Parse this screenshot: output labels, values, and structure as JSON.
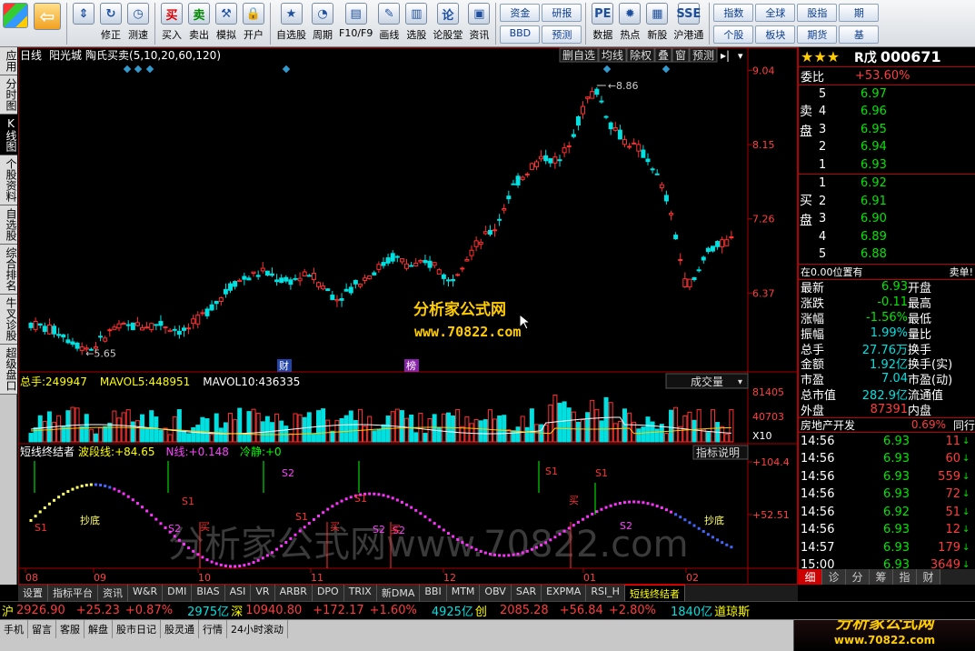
{
  "toolbar": {
    "groups": [
      [
        {
          "label": "",
          "icon": "windows-logo"
        },
        {
          "label": "",
          "icon": "back-arrow"
        }
      ],
      [
        {
          "label": "",
          "icon": "up-down-arrows"
        },
        {
          "label": "修正",
          "icon": "refresh-icon"
        },
        {
          "label": "测速",
          "icon": "clock-icon"
        }
      ],
      [
        {
          "label": "买入",
          "icon": "buy-icon",
          "glyph": "买"
        },
        {
          "label": "卖出",
          "icon": "sell-icon",
          "glyph": "卖"
        },
        {
          "label": "模拟",
          "icon": "hammer-icon"
        },
        {
          "label": "开户",
          "icon": "lock-icon"
        }
      ],
      [
        {
          "label": "自选股",
          "icon": "star-icon"
        },
        {
          "label": "周期",
          "icon": "cycle-icon"
        },
        {
          "label": "F10/F9",
          "icon": "f10-icon"
        },
        {
          "label": "画线",
          "icon": "pen-icon"
        },
        {
          "label": "选股",
          "icon": "pick-icon"
        },
        {
          "label": "论股堂",
          "icon": "forum-icon",
          "glyph": "论"
        },
        {
          "label": "资讯",
          "icon": "news-icon"
        }
      ],
      [
        {
          "label": "资金",
          "small": true
        },
        {
          "label": "研报",
          "small": true
        },
        {
          "label": "BBD",
          "small": true
        },
        {
          "label": "预测",
          "small": true
        }
      ],
      [
        {
          "label": "数据",
          "icon": "pe-icon",
          "glyph": "PE"
        },
        {
          "label": "热点",
          "icon": "fire-icon"
        },
        {
          "label": "新股",
          "icon": "new-stock-icon"
        },
        {
          "label": "沪港通",
          "icon": "hk-icon",
          "glyph": "SSE"
        }
      ],
      [
        {
          "label": "指数",
          "small": true
        },
        {
          "label": "全球",
          "small": true
        },
        {
          "label": "股指",
          "small": true
        },
        {
          "label": "期",
          "small": true
        },
        {
          "label": "个股",
          "small": true
        },
        {
          "label": "板块",
          "small": true
        },
        {
          "label": "期货",
          "small": true
        },
        {
          "label": "基",
          "small": true
        }
      ]
    ]
  },
  "left_tabs": [
    {
      "label": "应用"
    },
    {
      "label": "分时图"
    },
    {
      "label": "K线图",
      "active": true
    },
    {
      "label": "个股资料"
    },
    {
      "label": "自选股"
    },
    {
      "label": "综合排名"
    },
    {
      "label": "牛叉诊股"
    },
    {
      "label": "超级盘口"
    }
  ],
  "main_chart": {
    "title_left": "日线",
    "stock_name": "阳光城",
    "indicator": "陶氏买卖(5,10,20,60,120)",
    "buttons": [
      "删自选",
      "均线",
      "除权",
      "叠",
      "窗",
      "预测"
    ],
    "price_labels": [
      "9.04",
      "8.15",
      "7.26",
      "6.37"
    ],
    "high_mark": "8.86",
    "low_mark": "5.65",
    "event_marks": [
      "财",
      "榜"
    ],
    "watermark_cn": "分析家公式网",
    "watermark_url": "www.70822.com"
  },
  "volume_panel": {
    "label_total": "总手:",
    "total": "249947",
    "mavol5_label": "MAVOL5:",
    "mavol5": "448951",
    "mavol10_label": "MAVOL10:",
    "mavol10": "436335",
    "dropdown": "成交量",
    "axis": [
      "81405",
      "40703",
      "X10"
    ]
  },
  "indicator_panel": {
    "name": "短线终结者",
    "wave_label": "波段线:",
    "wave": "+84.65",
    "n_label": "N线:",
    "n": "+0.148",
    "calm_label": "冷静:",
    "calm": "+0",
    "button": "指标说明",
    "axis": [
      "+104.4",
      "+52.51"
    ],
    "labels": [
      "S1",
      "抄底",
      "S2",
      "S1",
      "买",
      "S2",
      "S1",
      "S1",
      "买",
      "S2",
      "S2",
      "买",
      "S1",
      "买",
      "S1",
      "S2",
      "抄底"
    ],
    "watermark": "分析家公式网www.70822.com"
  },
  "x_axis": [
    "08",
    "09",
    "10",
    "11",
    "12",
    "01",
    "02"
  ],
  "right_panel": {
    "code_prefix": "R戊",
    "code": "000671",
    "weibi_label": "委比",
    "weibi": "+53.60%",
    "sell_label": "卖盘",
    "buy_label": "买盘",
    "sells": [
      {
        "n": "5",
        "p": "6.97"
      },
      {
        "n": "4",
        "p": "6.96"
      },
      {
        "n": "3",
        "p": "6.95"
      },
      {
        "n": "2",
        "p": "6.94"
      },
      {
        "n": "1",
        "p": "6.93"
      }
    ],
    "buys": [
      {
        "n": "1",
        "p": "6.92"
      },
      {
        "n": "2",
        "p": "6.91"
      },
      {
        "n": "3",
        "p": "6.90"
      },
      {
        "n": "4",
        "p": "6.89"
      },
      {
        "n": "5",
        "p": "6.88"
      }
    ],
    "pos_text": "在0.00位置有",
    "pos_right": "卖单!",
    "stats": [
      {
        "l": "最新",
        "v": "6.93",
        "r": "开盘"
      },
      {
        "l": "涨跌",
        "v": "-0.11",
        "r": "最高"
      },
      {
        "l": "涨幅",
        "v": "-1.56%",
        "r": "最低"
      },
      {
        "l": "振幅",
        "v": "1.99%",
        "r": "量比"
      },
      {
        "l": "总手",
        "v": "27.76万",
        "r": "换手"
      },
      {
        "l": "金额",
        "v": "1.92亿",
        "r": "换手(实)"
      },
      {
        "l": "市盈",
        "v": "7.04",
        "r": "市盈(动)"
      },
      {
        "l": "总市值",
        "v": "282.9亿",
        "r": "流通值"
      },
      {
        "l": "外盘",
        "v": "87391",
        "r": "内盘"
      }
    ],
    "sector": "房地产开发",
    "sector_pct": "0.69%",
    "sector_right": "同行",
    "ticks": [
      {
        "t": "14:56",
        "p": "6.93",
        "v": "11"
      },
      {
        "t": "14:56",
        "p": "6.93",
        "v": "60"
      },
      {
        "t": "14:56",
        "p": "6.93",
        "v": "559"
      },
      {
        "t": "14:56",
        "p": "6.93",
        "v": "72"
      },
      {
        "t": "14:56",
        "p": "6.92",
        "v": "51"
      },
      {
        "t": "14:56",
        "p": "6.93",
        "v": "12"
      },
      {
        "t": "14:57",
        "p": "6.93",
        "v": "179"
      },
      {
        "t": "15:00",
        "p": "6.93",
        "v": "3649"
      }
    ],
    "bottom_tabs": [
      "细",
      "诊",
      "分",
      "筹",
      "指",
      "财"
    ]
  },
  "bottom_tabs": [
    "设置",
    "指标平台",
    "资讯",
    "W&R",
    "DMI",
    "BIAS",
    "ASI",
    "VR",
    "ARBR",
    "DPO",
    "TRIX",
    "新DMA",
    "BBI",
    "MTM",
    "OBV",
    "SAR",
    "EXPMA",
    "RSI_H",
    "短线终结者"
  ],
  "status": {
    "sh_label": "沪",
    "sh": "2926.90",
    "sh_chg": "+25.23",
    "sh_pct": "+0.87%",
    "sh_amt": "2975亿",
    "sz_label": "深",
    "sz": "10940.80",
    "sz_chg": "+172.17",
    "sz_pct": "+1.60%",
    "sz_amt": "4925亿",
    "cy_label": "创",
    "cy": "2085.28",
    "cy_chg": "+56.84",
    "cy_pct": "+2.80%",
    "cy_amt": "1840亿",
    "dj": "道琼斯"
  },
  "status2": [
    "手机",
    "留言",
    "客服",
    "解盘",
    "股市日记",
    "股灵通",
    "行情",
    "24小时滚动"
  ],
  "brand": {
    "name": "分析家公式网",
    "url": "www.70822.com"
  }
}
